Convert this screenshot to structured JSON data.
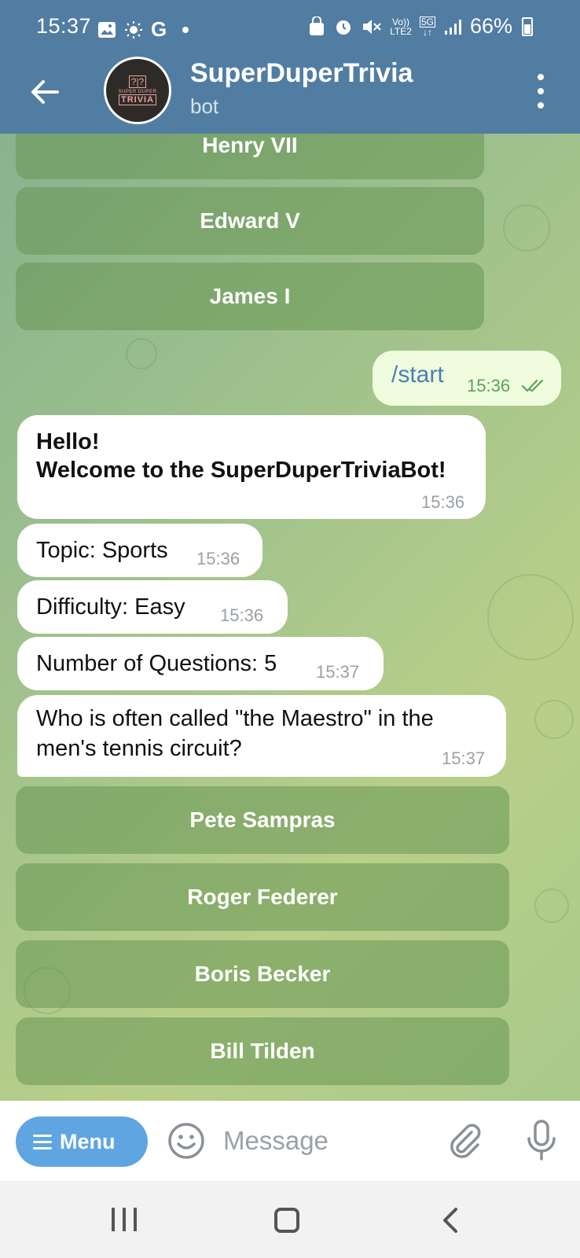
{
  "status": {
    "time": "15:37",
    "left_icons": [
      "image-icon",
      "brightness-icon",
      "google-icon",
      "dot-icon"
    ],
    "g_letter": "G",
    "network_top": "Vo))",
    "network_bottom": "LTE2",
    "net_type": "5G",
    "battery": "66%"
  },
  "header": {
    "title": "SuperDuperTrivia",
    "subtitle": "bot",
    "avatar": {
      "top": "?|?",
      "small": "SUPER DUPER",
      "big": "TRIVIA"
    }
  },
  "chat": {
    "previous_answers": [
      "Henry VII",
      "Edward V",
      "James I"
    ],
    "outgoing": {
      "text": "/start",
      "time": "15:36",
      "status": "read"
    },
    "welcome": {
      "line1": "Hello!",
      "line2": "Welcome to the SuperDuperTriviaBot!",
      "time": "15:36"
    },
    "topic": {
      "text": "Topic: Sports",
      "time": "15:36"
    },
    "difficulty": {
      "text": "Difficulty: Easy",
      "time": "15:36"
    },
    "num_questions": {
      "text": "Number of Questions: 5",
      "time": "15:37"
    },
    "question": {
      "line1": "Who is often called \"the Maestro\" in the",
      "line2": "men's tennis circuit?",
      "time": "15:37"
    },
    "answers": [
      "Pete Sampras",
      "Roger Federer",
      "Boris Becker",
      "Bill Tilden"
    ]
  },
  "input": {
    "menu_label": "Menu",
    "placeholder": "Message"
  },
  "colors": {
    "header": "#517da2",
    "out_bubble": "#effdde",
    "menu_button": "#5fa5e2",
    "keyboard_button": "#679654"
  }
}
